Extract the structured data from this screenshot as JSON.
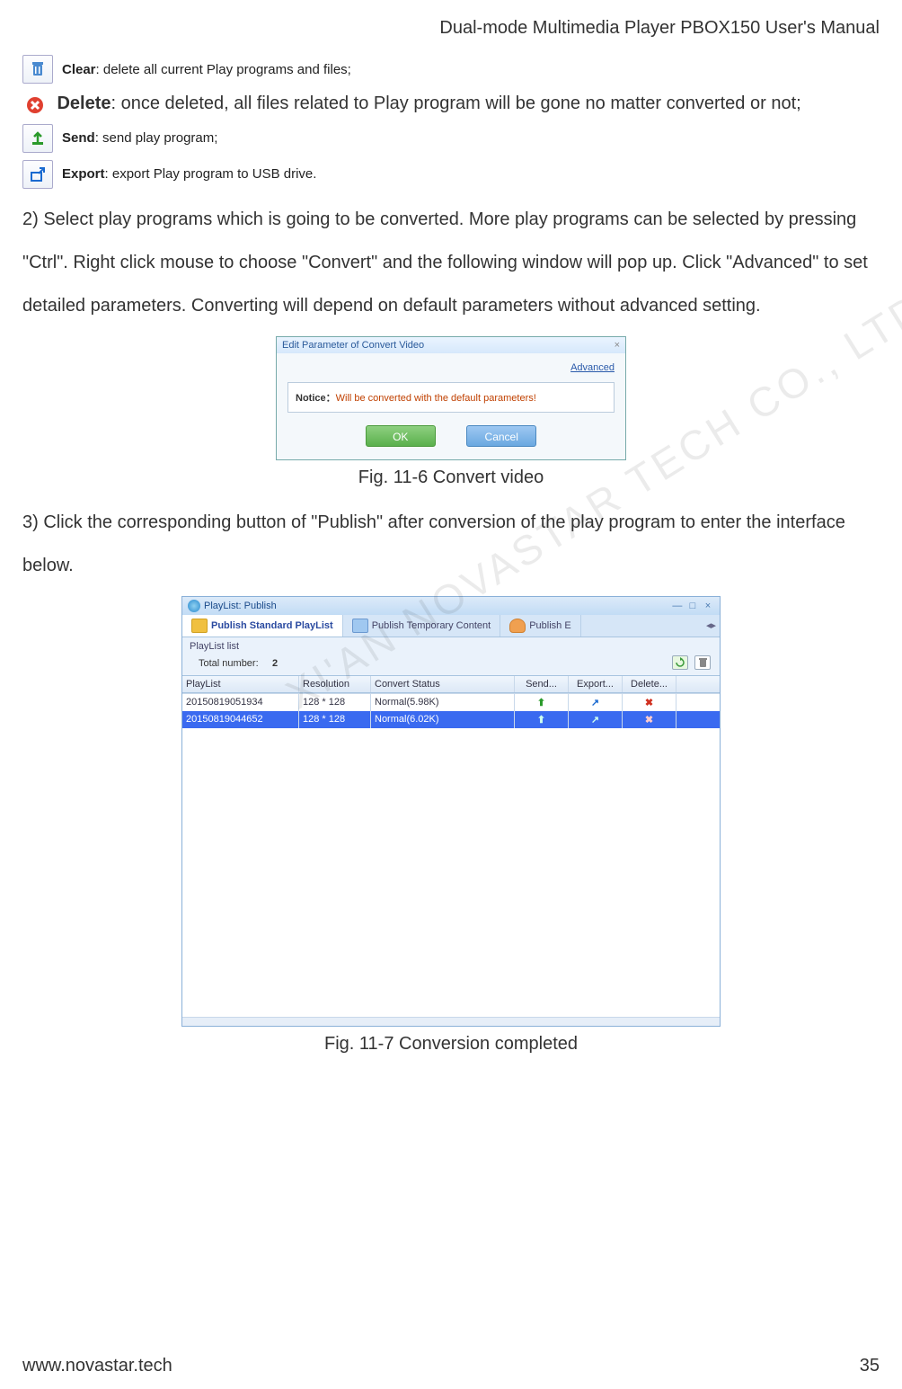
{
  "header": "Dual-mode Multimedia Player PBOX150 User's Manual",
  "items": {
    "clear": {
      "label": "Clear",
      "desc": ": delete all current Play programs and files;"
    },
    "delete": {
      "label": "Delete",
      "desc": ": once deleted, all files related to Play program will be gone no matter converted or not;"
    },
    "send": {
      "label": "Send",
      "desc": ": send play program;"
    },
    "export": {
      "label": "Export",
      "desc": ": export Play program to USB drive."
    }
  },
  "para2": "2) Select play programs which is going to be converted. More play programs can be selected by pressing \"Ctrl\". Right click mouse to choose \"Convert\" and the following window will pop up. Click \"Advanced\" to set detailed parameters. Converting will depend on default parameters without advanced setting.",
  "fig1": {
    "title": "Edit Parameter of Convert Video",
    "advanced": "Advanced",
    "noticeLabel": "Notice：",
    "noticeText": "Will be converted with the default parameters!",
    "ok": "OK",
    "cancel": "Cancel",
    "caption": "Fig. 11-6 Convert video"
  },
  "para3": "3) Click the corresponding button of \"Publish\" after conversion of the play program to enter the interface below.",
  "fig2": {
    "title": "PlayList: Publish",
    "tabs": {
      "t1": "Publish Standard PlayList",
      "t2": "Publish Temporary Content",
      "t3": "Publish E"
    },
    "listLabel": "PlayList list",
    "totalLabel": "Total number:",
    "totalValue": "2",
    "cols": {
      "c1": "PlayList",
      "c2": "Resolution",
      "c3": "Convert Status",
      "c4": "Send...",
      "c5": "Export...",
      "c6": "Delete..."
    },
    "rows": [
      {
        "name": "20150819051934",
        "res": "128 * 128",
        "status": "Normal(5.98K)"
      },
      {
        "name": "20150819044652",
        "res": "128 * 128",
        "status": "Normal(6.02K)"
      }
    ],
    "caption": "Fig. 11-7 Conversion completed"
  },
  "footer": {
    "site": "www.novastar.tech",
    "page": "35"
  },
  "watermark": "XI'AN NOVASTAR TECH CO., LTD"
}
